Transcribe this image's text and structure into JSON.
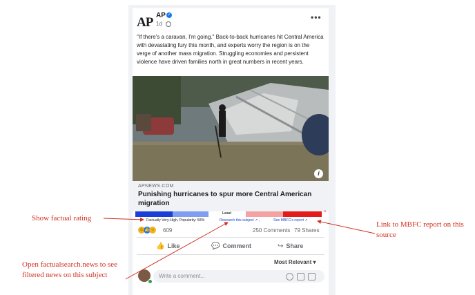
{
  "post": {
    "author": "AP",
    "avatar_text": "AP",
    "time": "1d",
    "more_label": "•••",
    "caption": "\"If there's a caravan, I'm going.\" Back-to-back hurricanes hit Central America with devastating fury this month, and experts worry the region is on the verge of another mass migration. Struggling economies and persistent violence have driven families north in great numbers in recent years.",
    "info_label": "i"
  },
  "link": {
    "domain": "APNEWS.COM",
    "headline": "Punishing hurricanes to spur more Central American migration"
  },
  "mbfc_bar": {
    "bias_label": "Least",
    "close_label": "×",
    "colors": {
      "far_left": "#1a3fd6",
      "left": "#7f9ef0",
      "center": "#ffffff",
      "right": "#f4a3a3",
      "far_right": "#e31b1b"
    },
    "factual": "Factually Very-High,  Popularity: 58%",
    "research": "Research this subject ↗ ,",
    "report": "See MBFC's report ↗"
  },
  "reactions": {
    "count": "609",
    "comments": "250 Comments",
    "shares": "79 Shares",
    "icons": [
      "haha-icon",
      "like-icon",
      "wow-icon"
    ]
  },
  "actions": {
    "like": "Like",
    "comment": "Comment",
    "share": "Share"
  },
  "comments": {
    "sort_label": "Most Relevant ▾",
    "placeholder": "Write a comment..."
  },
  "annotations": {
    "factual": "Show factual rating",
    "mbfc": "Link to MBFC report on this source",
    "research": "Open factualsearch.news to see filtered news on this subject"
  },
  "colors": {
    "annotation": "#d03020",
    "link_blue": "#1a47c9",
    "verified": "#1877f2"
  }
}
